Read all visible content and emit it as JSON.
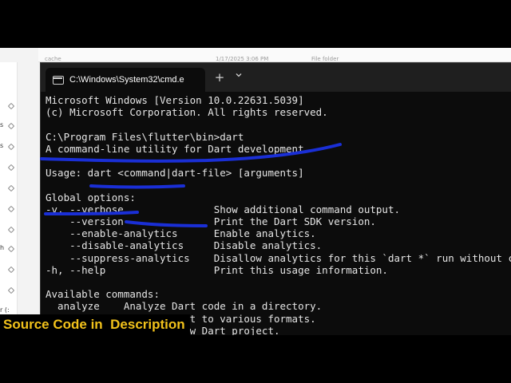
{
  "explorer": {
    "header_fragments": [
      "cache",
      "1/17/2025 3:06 PM",
      "File folder"
    ],
    "sidebar_fragments": [
      "s",
      "s",
      "h",
      "r (:"
    ]
  },
  "terminal": {
    "tab_title": "C:\\Windows\\System32\\cmd.e",
    "new_tab_label": "+",
    "dropdown_label": "⌄",
    "lines": [
      "Microsoft Windows [Version 10.0.22631.5039]",
      "(c) Microsoft Corporation. All rights reserved.",
      "",
      "C:\\Program Files\\flutter\\bin>dart",
      "A command-line utility for Dart development.",
      "",
      "Usage: dart <command|dart-file> [arguments]",
      "",
      "Global options:",
      "-v, --verbose               Show additional command output.",
      "    --version               Print the Dart SDK version.",
      "    --enable-analytics      Enable analytics.",
      "    --disable-analytics     Disable analytics.",
      "    --suppress-analytics    Disallow analytics for this `dart *` run without changing the analytics configuration.",
      "-h, --help                  Print this usage information.",
      "",
      "Available commands:",
      "  analyze    Analyze Dart code in a directory.",
      "  compile    Compile Dart to various formats.",
      "  create     Create a new Dart project."
    ]
  },
  "caption": {
    "text": "Source Code in  Description",
    "color": "#f2c21b"
  },
  "annotation_color": "#1a2fd6"
}
